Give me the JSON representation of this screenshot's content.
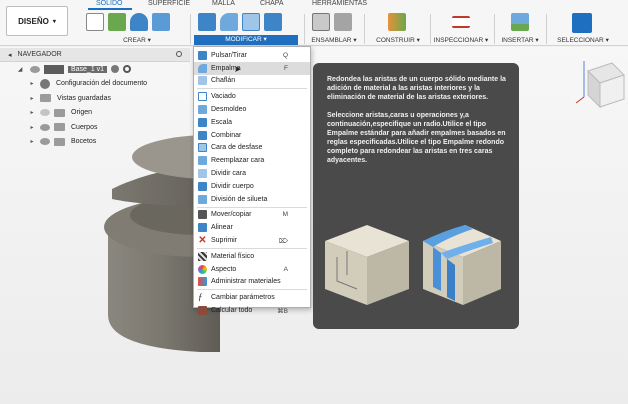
{
  "design_menu": "DISEÑO",
  "tabs": [
    "SÓLIDO",
    "SUPERFICIE",
    "MALLA",
    "CHAPA",
    "HERRAMIENTAS"
  ],
  "groups": [
    "CREAR",
    "MODIFICAR",
    "ENSAMBLAR",
    "CONSTRUIR",
    "INSPECCIONAR",
    "INSERTAR",
    "SELECCIONAR"
  ],
  "navigator": {
    "title": "NAVEGADOR",
    "component": "Base_1 v1",
    "items": [
      "Configuración del documento",
      "Vistas guardadas",
      "Origen",
      "Cuerpos",
      "Bocetos"
    ]
  },
  "menu": {
    "items": [
      {
        "label": "Pulsar/Tirar",
        "shortcut": "Q"
      },
      {
        "label": "Empalme",
        "shortcut": "F"
      },
      {
        "label": "Chaflán",
        "shortcut": ""
      },
      {
        "label": "Vaciado",
        "shortcut": ""
      },
      {
        "label": "Desmoldeo",
        "shortcut": ""
      },
      {
        "label": "Escala",
        "shortcut": ""
      },
      {
        "label": "Combinar",
        "shortcut": ""
      },
      {
        "label": "Cara de desfase",
        "shortcut": ""
      },
      {
        "label": "Reemplazar cara",
        "shortcut": ""
      },
      {
        "label": "Dividir cara",
        "shortcut": ""
      },
      {
        "label": "Dividir cuerpo",
        "shortcut": ""
      },
      {
        "label": "División de silueta",
        "shortcut": ""
      },
      {
        "label": "Mover/copiar",
        "shortcut": "M"
      },
      {
        "label": "Alinear",
        "shortcut": ""
      },
      {
        "label": "Suprimir",
        "shortcut": "⌦"
      },
      {
        "label": "Material físico",
        "shortcut": ""
      },
      {
        "label": "Aspecto",
        "shortcut": "A"
      },
      {
        "label": "Administrar materiales",
        "shortcut": ""
      },
      {
        "label": "Cambiar parámetros",
        "shortcut": ""
      },
      {
        "label": "Calcular todo",
        "shortcut": "⌘B"
      }
    ]
  },
  "tooltip": {
    "p1": "Redondea las aristas de un cuerpo sólido mediante la adición de material a las aristas interiores y la eliminación de material de las aristas exteriores.",
    "p2": "Seleccione aristas,caras u operaciones y,a continuación,especifique un radio.Utilice el tipo Empalme estándar para añadir empalmes basados en reglas especificadas.Utilice el tipo Empalme redondo completo para redondear las aristas en tres caras adyacentes."
  },
  "colors": {
    "accent": "#1f6fc0",
    "tooltip_bg": "#4a4a4a"
  }
}
